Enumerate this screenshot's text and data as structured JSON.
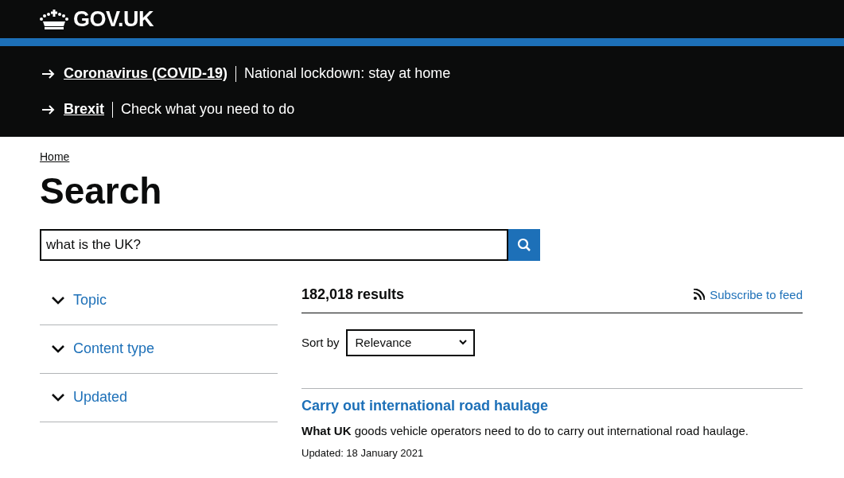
{
  "header": {
    "logo_text": "GOV.UK"
  },
  "banners": [
    {
      "link": "Coronavirus (COVID-19)",
      "text": "National lockdown: stay at home"
    },
    {
      "link": "Brexit",
      "text": "Check what you need to do"
    }
  ],
  "breadcrumb": [
    "Home"
  ],
  "page_title": "Search",
  "search": {
    "value": "what is the UK?"
  },
  "facets": [
    {
      "label": "Topic",
      "expanded": false
    },
    {
      "label": "Content type",
      "expanded": false
    },
    {
      "label": "Updated",
      "expanded": false
    }
  ],
  "results_count": "182,018 results",
  "subscribe": "Subscribe to feed",
  "sort": {
    "label": "Sort by",
    "value": "Relevance"
  },
  "results": [
    {
      "title": "Carry out international road haulage",
      "description": "**What UK** goods vehicle operators need to do to carry out international road haulage.",
      "updated": "Updated: 18 January 2021"
    }
  ]
}
